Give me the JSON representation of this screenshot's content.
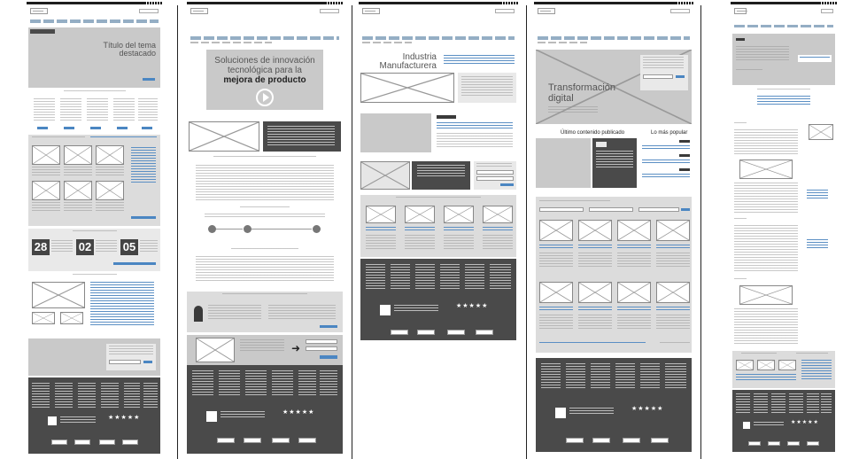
{
  "wireframes": {
    "w1": {
      "hero_title": "Título del tema\ndestacado",
      "dates": [
        "28",
        "02",
        "05"
      ]
    },
    "w2": {
      "hero_title_lines": [
        "Soluciones de innovación",
        "tecnológica para la"
      ],
      "hero_title_bold": "mejora de producto"
    },
    "w3": {
      "title_lines": [
        "Industria",
        "Manufacturera"
      ]
    },
    "w4": {
      "hero_title_lines": [
        "Transformación",
        "digital"
      ],
      "col_left": "Último contenido publicado",
      "col_right": "Lo más popular"
    },
    "w5": {}
  },
  "colors": {
    "accent": "#4b86c2",
    "dark": "#4a4a4a",
    "gray": "#c9c9c9"
  },
  "icons": {
    "placeholder": "image-placeholder-icon",
    "play": "play-icon",
    "person": "person-icon",
    "arrow": "arrow-right-icon",
    "stars": "rating-stars-icon"
  },
  "stars": "★★★★★"
}
